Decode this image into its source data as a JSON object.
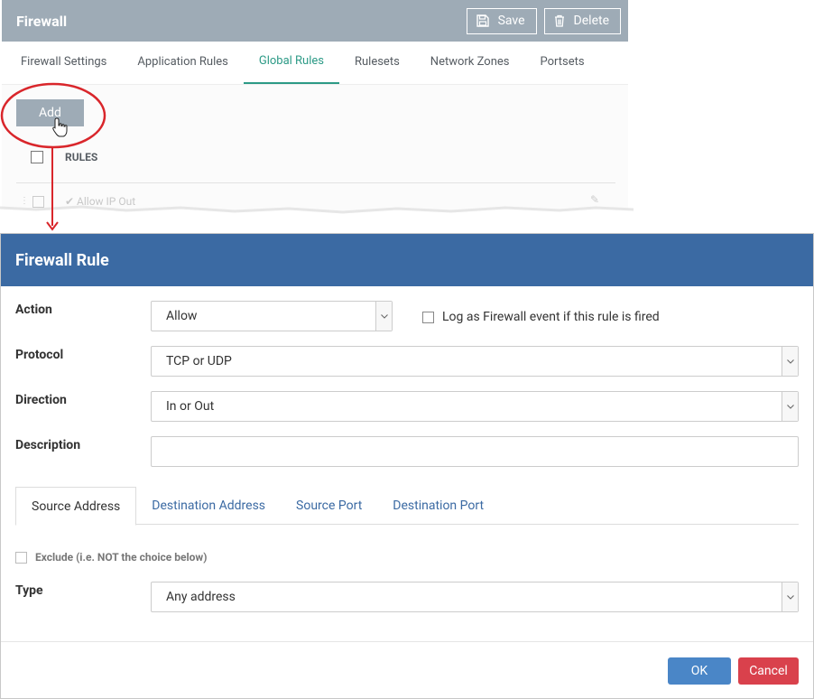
{
  "background_window": {
    "title": "Firewall",
    "save_label": "Save",
    "delete_label": "Delete",
    "tabs": [
      {
        "label": "Firewall Settings"
      },
      {
        "label": "Application Rules"
      },
      {
        "label": "Global Rules"
      },
      {
        "label": "Rulesets"
      },
      {
        "label": "Network Zones"
      },
      {
        "label": "Portsets"
      }
    ],
    "active_tab": "Global Rules",
    "add_label": "Add",
    "rules_header": "RULES",
    "row_text": "Allow IP Out"
  },
  "annotation": {
    "highlight_color": "#d9262b"
  },
  "dialog": {
    "title": "Firewall Rule",
    "action": {
      "label": "Action",
      "value": "Allow"
    },
    "log_checkbox_label": "Log as Firewall event if this rule is fired",
    "protocol": {
      "label": "Protocol",
      "value": "TCP or UDP"
    },
    "direction": {
      "label": "Direction",
      "value": "In or Out"
    },
    "description": {
      "label": "Description",
      "value": ""
    },
    "tabs": [
      {
        "label": "Source Address"
      },
      {
        "label": "Destination Address"
      },
      {
        "label": "Source Port"
      },
      {
        "label": "Destination Port"
      }
    ],
    "active_tab": "Source Address",
    "exclude_label": "Exclude (i.e. NOT the choice below)",
    "type": {
      "label": "Type",
      "value": "Any address"
    },
    "ok_label": "OK",
    "cancel_label": "Cancel"
  },
  "colors": {
    "dialog_header": "#3b6aa3",
    "bg_header": "#9eabb6",
    "active_tab_green": "#2c9a86",
    "ok_button": "#4a86c7",
    "cancel_button": "#d9414c"
  }
}
